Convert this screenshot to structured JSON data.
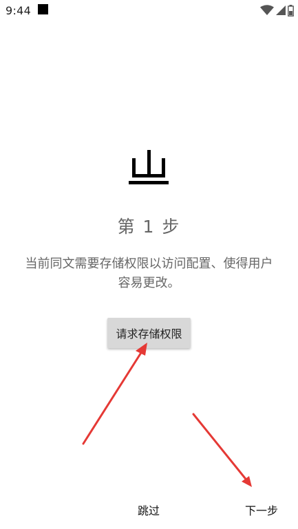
{
  "status_bar": {
    "time": "9:44",
    "icons": [
      "notification-square-icon",
      "wifi-icon",
      "cell-signal-icon",
      "battery-icon"
    ]
  },
  "logo": {
    "icon": "app-logo-icon"
  },
  "step": {
    "title": "第 1 步",
    "description": "当前同文需要存储权限以访问配置、使得用户容易更改。"
  },
  "buttons": {
    "request_permission": "请求存储权限",
    "skip": "跳过",
    "next": "下一步"
  },
  "annotations": {
    "arrow_color": "#e53935"
  },
  "colors": {
    "background": "#ffffff",
    "text_secondary": "#666666",
    "button_bg": "#d8d8d8"
  }
}
